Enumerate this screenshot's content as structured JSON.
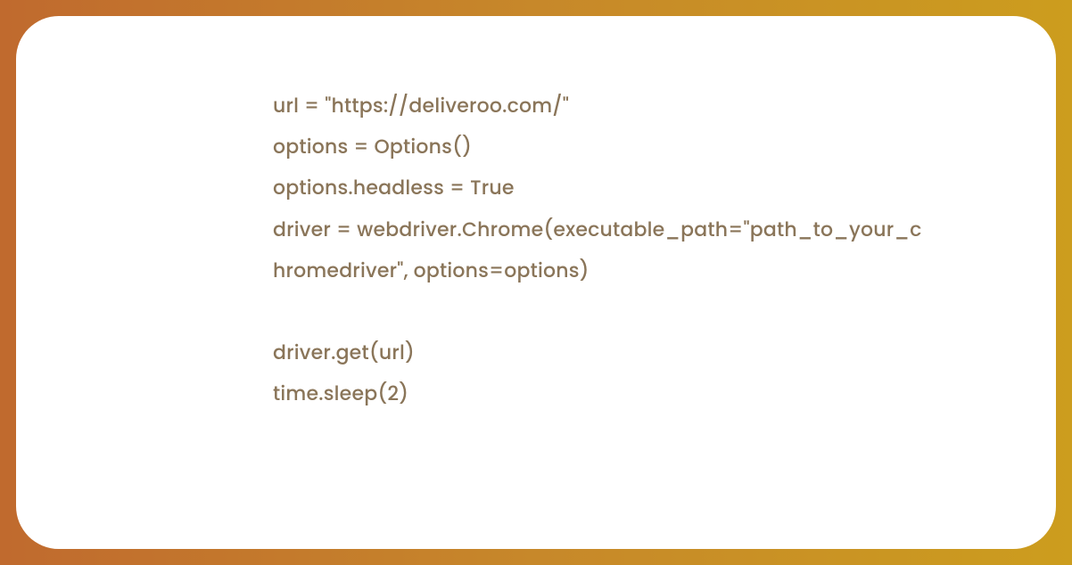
{
  "code": {
    "lines": [
      "url = \"https://deliveroo.com/\"",
      "options = Options()",
      "options.headless = True",
      "driver = webdriver.Chrome(executable_path=\"path_to_your_chromedriver\", options=options)",
      "",
      "driver.get(url)",
      "time.sleep(2)"
    ]
  },
  "colors": {
    "gradient_start": "#c06a2e",
    "gradient_end": "#cc9d1e",
    "card_bg": "#ffffff",
    "text": "#8a7559"
  }
}
